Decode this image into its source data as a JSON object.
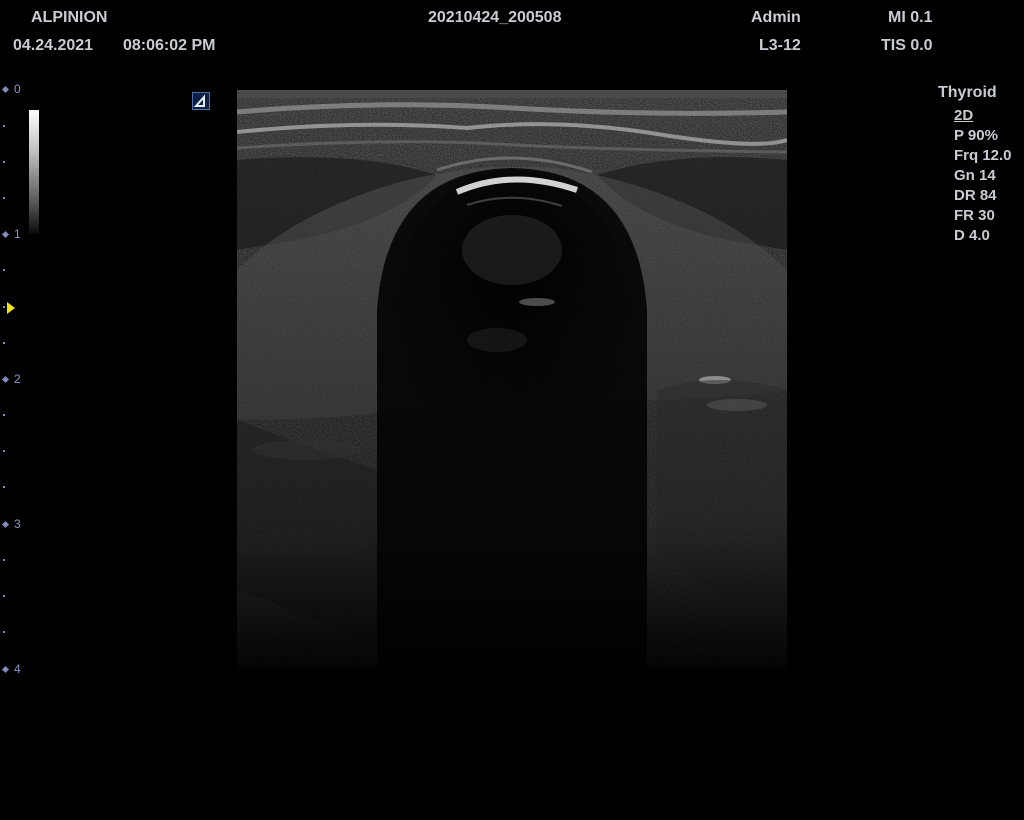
{
  "header": {
    "brand": "ALPINION",
    "date": "04.24.2021",
    "time": "08:06:02 PM",
    "study_id": "20210424_200508",
    "user": "Admin",
    "probe": "L3-12",
    "mi": "MI 0.1",
    "tis": "TIS 0.0"
  },
  "depth_scale": {
    "labels": [
      "0",
      "1",
      "2",
      "3",
      "4"
    ],
    "focus_depth_cm": 1.5
  },
  "gray_scale_bar": {
    "top_color": "#ffffff",
    "bottom_color": "#000000"
  },
  "orientation_marker": {
    "icon": "probe-orientation-icon",
    "color": "#4f6fa8"
  },
  "parameters": {
    "preset": "Thyroid",
    "mode": "2D",
    "power": "P 90%",
    "frequency": "Frq 12.0",
    "gain": "Gn 14",
    "dynamic_range": "DR 84",
    "frame_rate": "FR 30",
    "depth": "D 4.0"
  },
  "colors": {
    "text": "#c9ccd2",
    "ruler": "#7f8bbf",
    "focus_marker": "#f2e61a",
    "background": "#000000"
  }
}
